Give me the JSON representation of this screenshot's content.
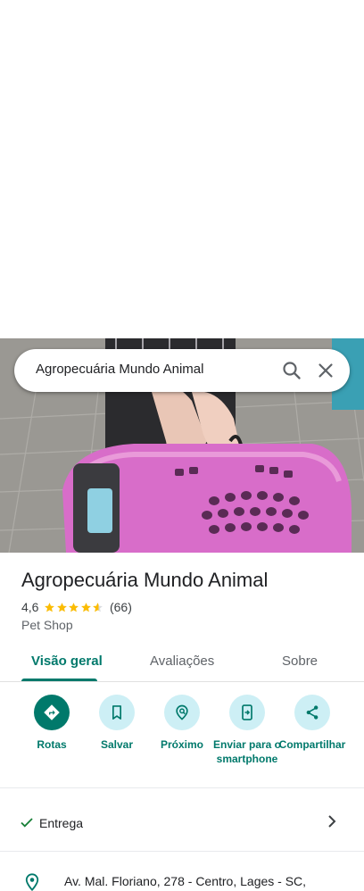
{
  "search": {
    "query": "Agropecuária Mundo Animal"
  },
  "icons": {
    "search": "search-icon",
    "close": "close-icon",
    "check": "check-icon",
    "chevron": "chevron-right-icon",
    "pin": "location-pin-icon"
  },
  "place": {
    "name": "Agropecuária Mundo Animal",
    "rating": "4,6",
    "rating_value": 4.6,
    "reviews": "(66)",
    "category": "Pet Shop"
  },
  "tabs": [
    {
      "label": "Visão geral",
      "active": true
    },
    {
      "label": "Avaliações",
      "active": false
    },
    {
      "label": "Sobre",
      "active": false
    }
  ],
  "actions": [
    {
      "label": "Rotas",
      "icon": "directions-icon"
    },
    {
      "label": "Salvar",
      "icon": "bookmark-icon"
    },
    {
      "label": "Próximo",
      "icon": "nearby-icon"
    },
    {
      "label": "Enviar para o smartphone",
      "icon": "send-to-phone-icon"
    },
    {
      "label": "Compartilhar",
      "icon": "share-icon"
    }
  ],
  "delivery": {
    "label": "Entrega"
  },
  "address": {
    "text": "Av. Mal. Floriano, 278 - Centro, Lages - SC,"
  },
  "colors": {
    "accent": "#00796b",
    "action_bg": "#cdeff5",
    "star": "#fbbc04",
    "check": "#188038"
  }
}
